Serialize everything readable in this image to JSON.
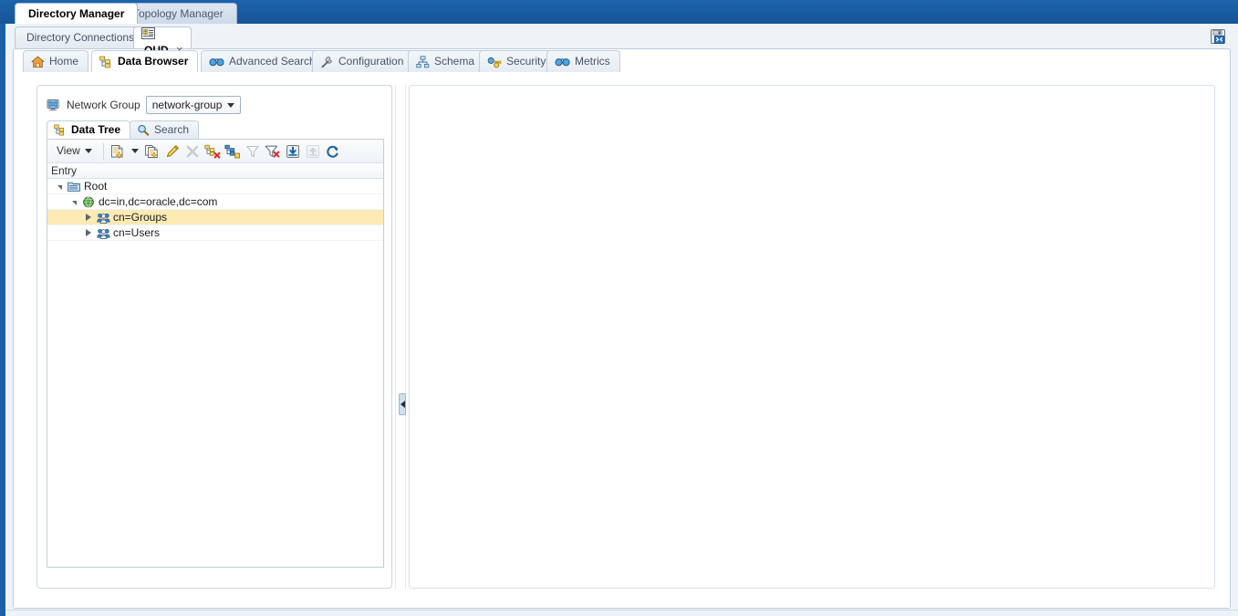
{
  "app": {
    "tabs": [
      {
        "label": "Directory Manager",
        "active": true
      },
      {
        "label": "Topology Manager",
        "active": false
      }
    ]
  },
  "connection": {
    "tabs": [
      {
        "label": "Directory Connections",
        "active": false,
        "closable": false
      },
      {
        "label": "OUD",
        "active": true,
        "closable": true,
        "icon": "connection-card-icon"
      }
    ],
    "close_glyph": "×",
    "save_icon": "save-all-icon"
  },
  "feature_tabs": [
    {
      "label": "Home",
      "icon": "home-icon",
      "active": false
    },
    {
      "label": "Data Browser",
      "icon": "data-browser-icon",
      "active": true
    },
    {
      "label": "Advanced Search",
      "icon": "binoculars-icon",
      "active": false
    },
    {
      "label": "Configuration",
      "icon": "wrench-icon",
      "active": false
    },
    {
      "label": "Schema",
      "icon": "schema-icon",
      "active": false
    },
    {
      "label": "Security",
      "icon": "key-icon",
      "active": false
    },
    {
      "label": "Metrics",
      "icon": "binoculars-icon",
      "active": false
    }
  ],
  "network_group": {
    "icon": "network-group-icon",
    "label": "Network Group",
    "selected": "network-group",
    "options": [
      "network-group"
    ]
  },
  "inner_tabs": [
    {
      "label": "Data Tree",
      "icon": "data-tree-icon",
      "active": true
    },
    {
      "label": "Search",
      "icon": "magnifier-icon",
      "active": false
    }
  ],
  "toolbar": {
    "view_label": "View",
    "buttons": [
      {
        "name": "new-entry-button",
        "icon": "new-entry-icon",
        "disabled": false
      },
      {
        "name": "new-entry-dropdown",
        "icon": "caret-down-icon",
        "disabled": false
      },
      {
        "name": "duplicate-entry-button",
        "icon": "duplicate-entry-icon",
        "disabled": false
      },
      {
        "name": "edit-entry-button",
        "icon": "pencil-icon",
        "disabled": false
      },
      {
        "name": "delete-entry-button",
        "icon": "delete-x-icon",
        "disabled": true
      },
      {
        "name": "delete-subtree-button",
        "icon": "delete-subtree-icon",
        "disabled": false
      },
      {
        "name": "copy-dn-button",
        "icon": "copy-dn-icon",
        "disabled": false
      },
      {
        "name": "filter-button",
        "icon": "funnel-icon",
        "disabled": true
      },
      {
        "name": "clear-filter-button",
        "icon": "funnel-clear-icon",
        "disabled": false
      },
      {
        "name": "import-ldif-button",
        "icon": "import-down-arrow-icon",
        "disabled": false
      },
      {
        "name": "export-ldif-button",
        "icon": "export-up-arrow-icon",
        "disabled": true
      },
      {
        "name": "refresh-button",
        "icon": "refresh-icon",
        "disabled": false
      }
    ]
  },
  "tree": {
    "column_header": "Entry",
    "rows": [
      {
        "label": "Root",
        "depth": 0,
        "state": "expanded",
        "icon": "root-folder-icon",
        "selected": false
      },
      {
        "label": "dc=in,dc=oracle,dc=com",
        "depth": 1,
        "state": "expanded",
        "icon": "domain-globe-icon",
        "selected": false
      },
      {
        "label": "cn=Groups",
        "depth": 2,
        "state": "collapsed",
        "icon": "group-icon",
        "selected": true
      },
      {
        "label": "cn=Users",
        "depth": 2,
        "state": "collapsed",
        "icon": "group-icon",
        "selected": false
      }
    ]
  },
  "splitter": {
    "name": "panel-collapse-handle",
    "direction": "left"
  },
  "colors": {
    "app_bar_blue": "#1b5fa8",
    "selection_yellow": "#fdeab4",
    "panel_border": "#c1cfdd",
    "page_background": "#eef3f8"
  }
}
